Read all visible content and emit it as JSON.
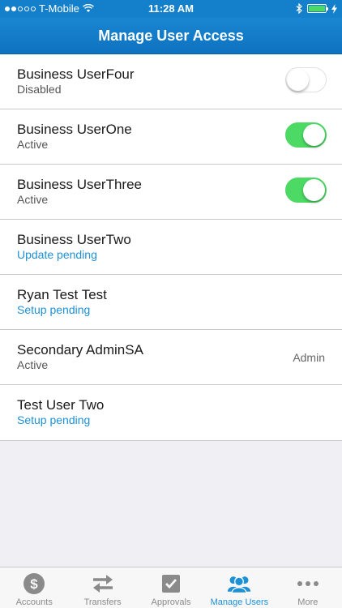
{
  "status_bar": {
    "carrier": "T-Mobile",
    "time": "11:28 AM",
    "battery_color": "#4cd964"
  },
  "nav": {
    "title": "Manage User Access"
  },
  "users": [
    {
      "name": "Business UserFour",
      "status": "Disabled"
    },
    {
      "name": "Business UserOne",
      "status": "Active"
    },
    {
      "name": "Business UserThree",
      "status": "Active"
    },
    {
      "name": "Business UserTwo",
      "status": "Update pending"
    },
    {
      "name": "Ryan Test Test",
      "status": "Setup pending"
    },
    {
      "name": "Secondary AdminSA",
      "status": "Active",
      "role": "Admin"
    },
    {
      "name": "Test User Two",
      "status": "Setup pending"
    }
  ],
  "tabs": [
    {
      "label": "Accounts",
      "icon": "dollar-icon"
    },
    {
      "label": "Transfers",
      "icon": "transfer-arrows-icon"
    },
    {
      "label": "Approvals",
      "icon": "checkbox-icon"
    },
    {
      "label": "Manage Users",
      "icon": "users-icon"
    },
    {
      "label": "More",
      "icon": "more-dots-icon"
    }
  ],
  "colors": {
    "brand_blue": "#1480cc",
    "toggle_on": "#4cd964",
    "pending_text": "#1e90d6",
    "active_tab": "#1e90d6",
    "inactive_tab": "#8a8a8a"
  }
}
